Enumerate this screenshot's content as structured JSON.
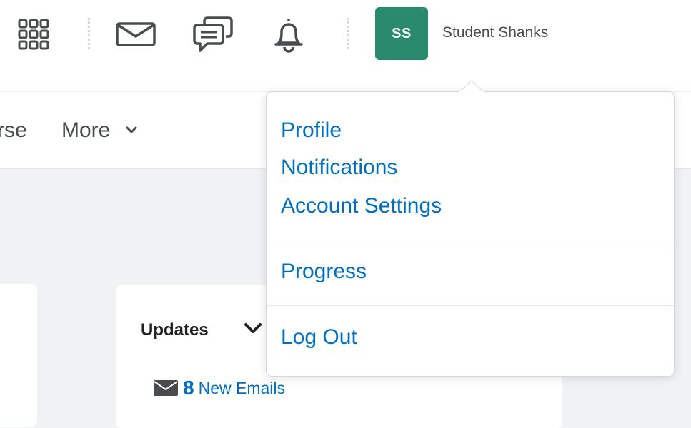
{
  "topbar": {
    "icons": [
      "waffle-grid-icon",
      "mail-icon",
      "chat-bubbles-icon",
      "bell-icon"
    ],
    "user": {
      "initials": "SS",
      "name": "Student Shanks"
    },
    "avatar_color": "#2a8a6e"
  },
  "navbar": {
    "items": [
      {
        "label": "rse"
      },
      {
        "label": "More"
      }
    ]
  },
  "updates": {
    "title": "Updates",
    "email_count": "8",
    "email_label": "New Emails"
  },
  "dropdown": {
    "items": [
      {
        "label": "Profile"
      },
      {
        "label": "Notifications"
      },
      {
        "label": "Account Settings"
      },
      {
        "label": "Progress"
      },
      {
        "label": "Log Out"
      }
    ]
  },
  "colors": {
    "link": "#006fbf",
    "text": "#494c4e",
    "background": "#f1f2f4"
  }
}
